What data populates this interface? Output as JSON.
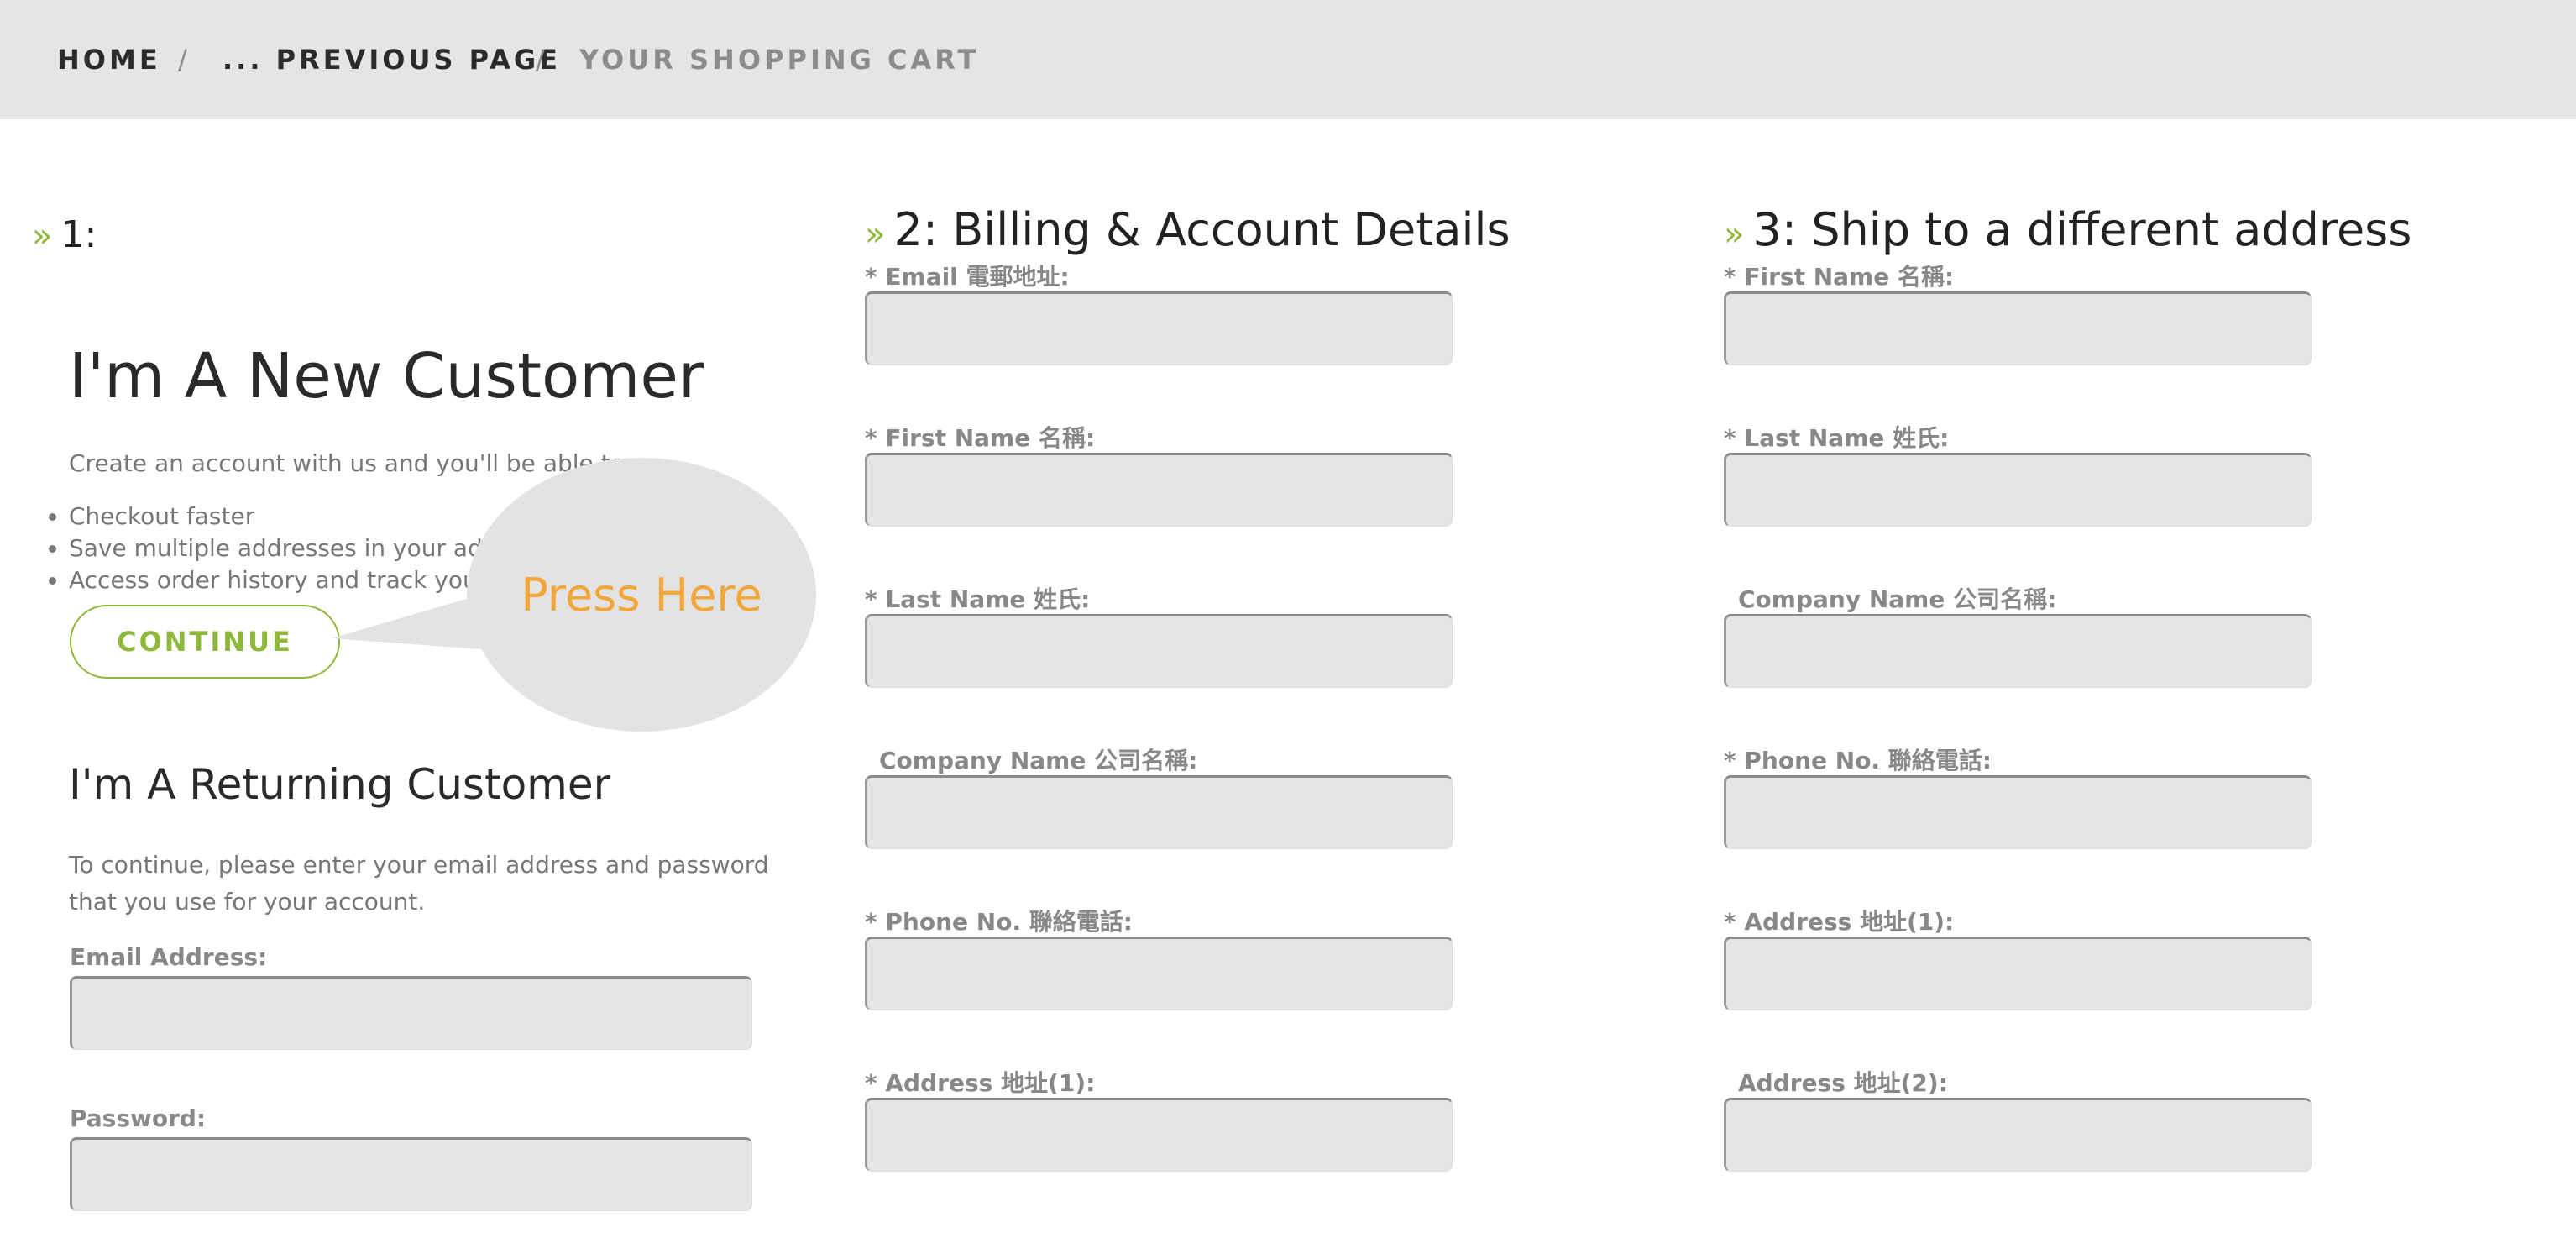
{
  "breadcrumb": {
    "home": "HOME",
    "previous": "... PREVIOUS PAGE",
    "current": "YOUR SHOPPING CART",
    "separator": "/"
  },
  "column1": {
    "step": "1:",
    "new_customer_title": "I'm A New Customer",
    "new_customer_text": "Create an account with us and you'll be able to:",
    "benefits": [
      "Checkout faster",
      "Save multiple addresses in your address book",
      "Access order history and track your orders"
    ],
    "continue_label": "CONTINUE",
    "bubble_text": "Press Here",
    "returning_title": "I'm A Returning Customer",
    "returning_text_line1": "To continue, please enter your email address and password",
    "returning_text_line2": "that you use for your account.",
    "email_label": "Email Address:",
    "password_label": "Password:"
  },
  "column2": {
    "title": "2: Billing & Account Details",
    "fields": [
      {
        "label": "* Email 電郵地址:"
      },
      {
        "label": "* First Name 名稱:"
      },
      {
        "label": "* Last Name 姓氏:"
      },
      {
        "label": "Company Name 公司名稱:"
      },
      {
        "label": "* Phone No. 聯絡電話:"
      },
      {
        "label": "* Address 地址(1):"
      }
    ]
  },
  "column3": {
    "title": "3: Ship to a different address",
    "fields": [
      {
        "label": "* First Name 名稱:"
      },
      {
        "label": "* Last Name 姓氏:"
      },
      {
        "label": "Company Name 公司名稱:"
      },
      {
        "label": "* Phone No. 聯絡電話:"
      },
      {
        "label": "* Address 地址(1):"
      },
      {
        "label": "Address 地址(2):"
      }
    ]
  },
  "colors": {
    "accent": "#8db83a",
    "bubble_text": "#f3a63a",
    "input_bg": "#e5e5e5",
    "header_bg": "#e5e5e5"
  }
}
